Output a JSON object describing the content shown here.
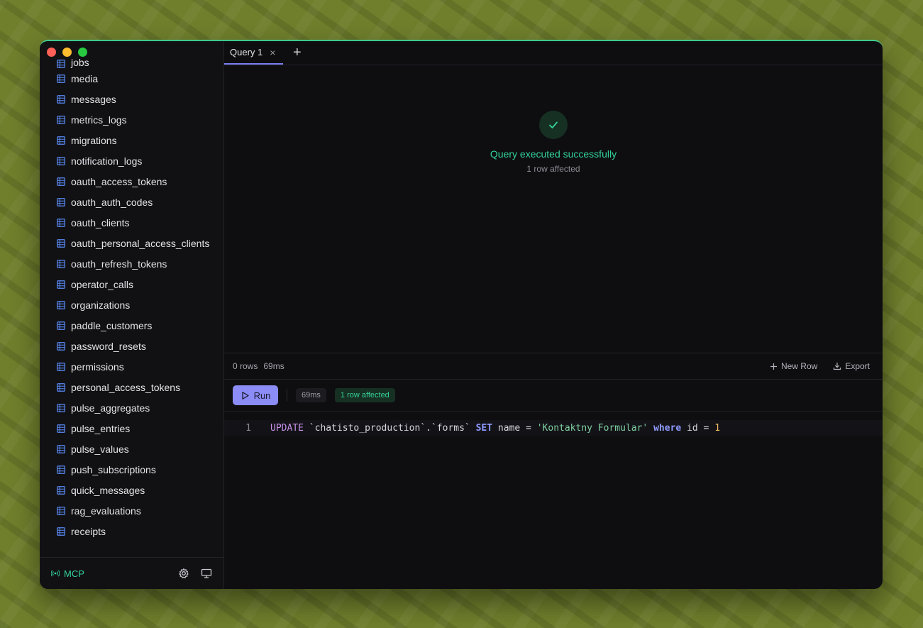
{
  "window": {
    "traffic_lights": [
      "close",
      "minimize",
      "maximize"
    ]
  },
  "sidebar": {
    "tables": [
      "jobs",
      "media",
      "messages",
      "metrics_logs",
      "migrations",
      "notification_logs",
      "oauth_access_tokens",
      "oauth_auth_codes",
      "oauth_clients",
      "oauth_personal_access_clients",
      "oauth_refresh_tokens",
      "operator_calls",
      "organizations",
      "paddle_customers",
      "password_resets",
      "permissions",
      "personal_access_tokens",
      "pulse_aggregates",
      "pulse_entries",
      "pulse_values",
      "push_subscriptions",
      "quick_messages",
      "rag_evaluations",
      "receipts"
    ],
    "footer": {
      "mcp_label": "MCP",
      "mcp_color": "#34d399"
    }
  },
  "tabs": {
    "items": [
      {
        "label": "Query 1",
        "active": true
      }
    ],
    "add_label": "+"
  },
  "result": {
    "title": "Query executed successfully",
    "subtitle": "1 row affected",
    "success_color": "#34d399"
  },
  "status": {
    "rows": "0 rows",
    "time": "69ms",
    "new_row_label": "New Row",
    "export_label": "Export"
  },
  "runbar": {
    "run_label": "Run",
    "time_badge": "69ms",
    "affected_badge": "1 row affected",
    "accent": "#8b8cf5"
  },
  "editor": {
    "line_number": "1",
    "tokens": {
      "update": "UPDATE",
      "table": "`chatisto_production`.`forms`",
      "set": "SET",
      "col": "name",
      "eq1": "=",
      "value": "'Kontaktny Formular'",
      "where": "where",
      "idcol": "id",
      "eq2": "=",
      "idval": "1"
    }
  }
}
